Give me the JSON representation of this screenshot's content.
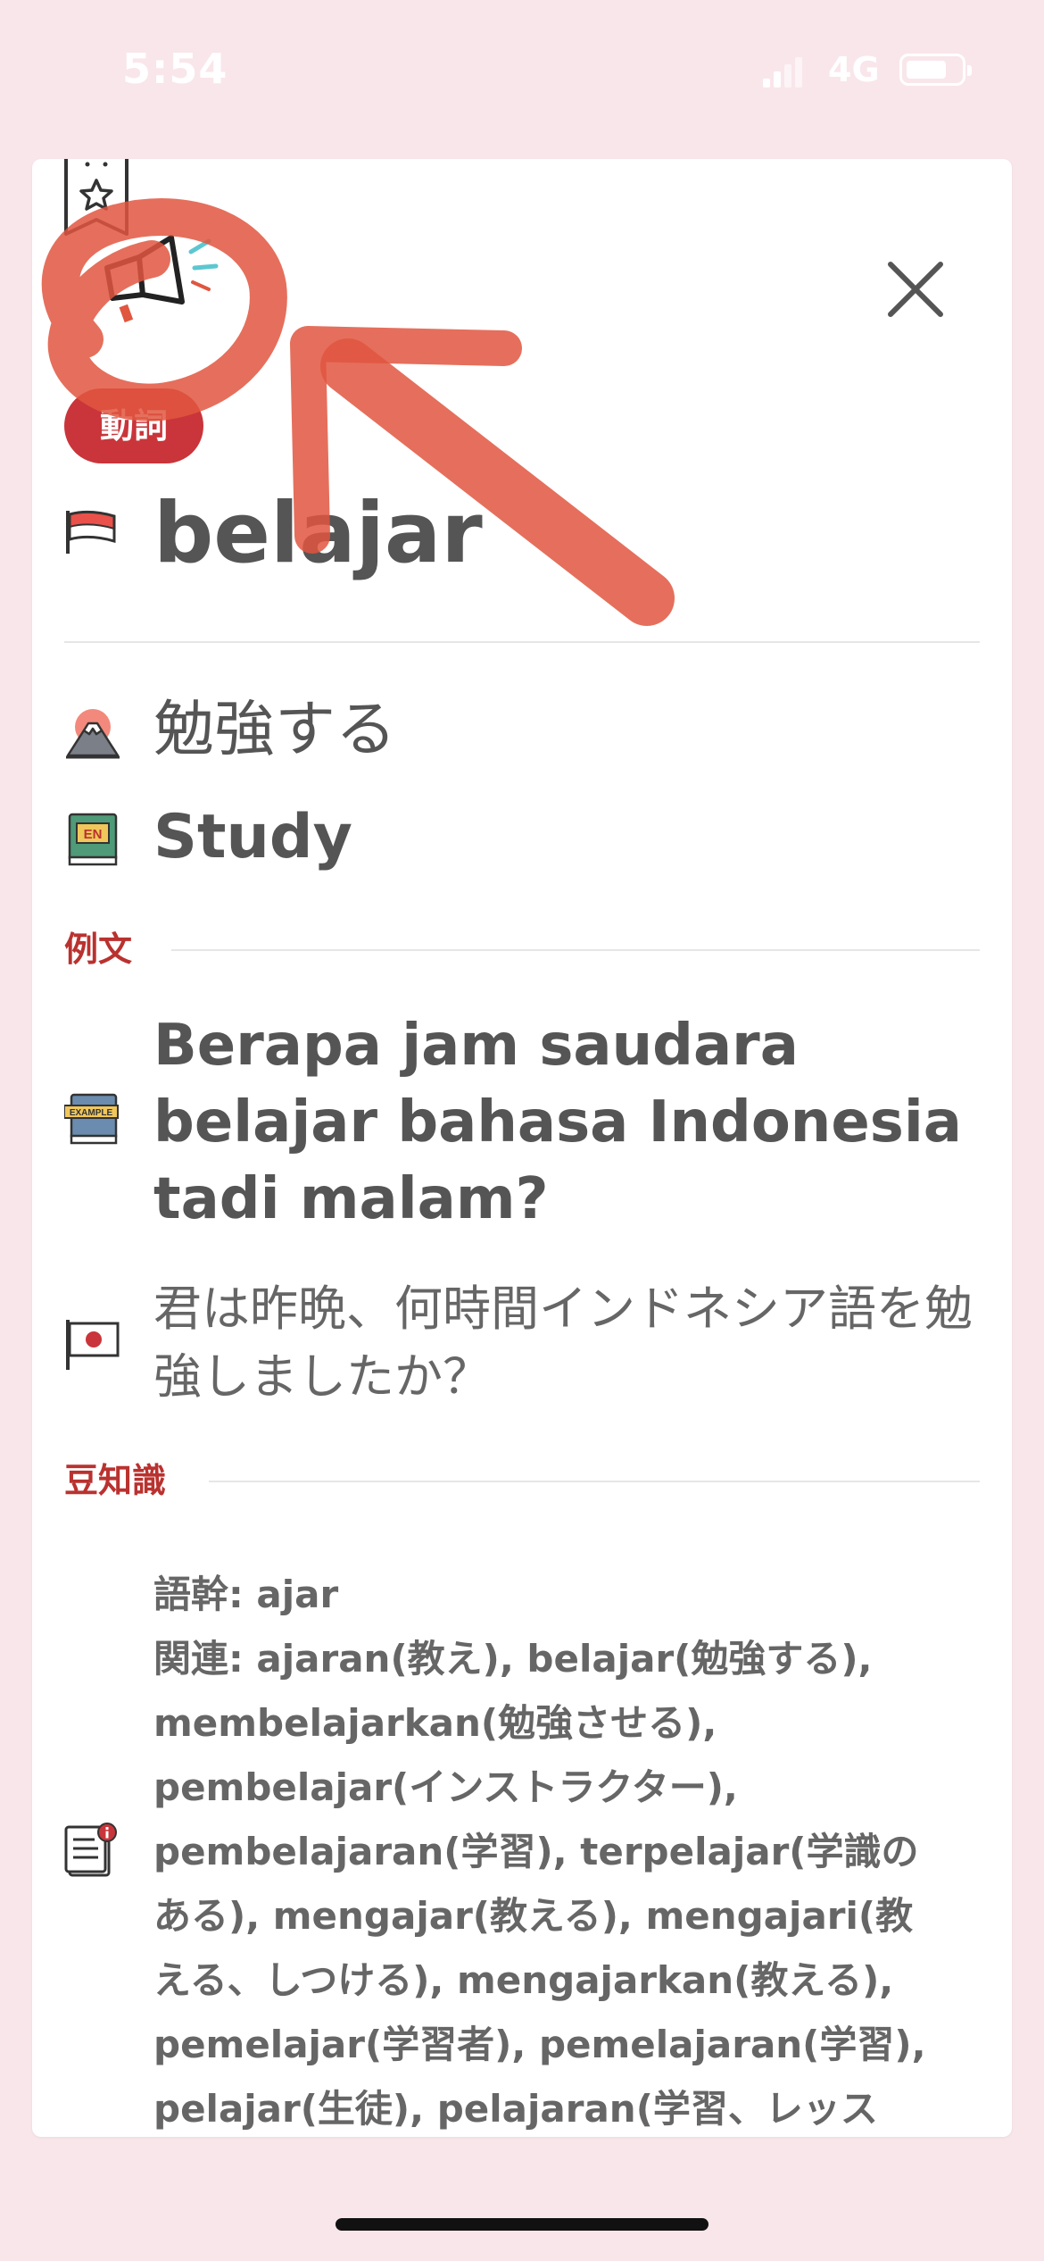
{
  "status_bar": {
    "time": "5:54",
    "network": "4G"
  },
  "card": {
    "part_of_speech": "動詞",
    "headword": "belajar",
    "translation_ja": "勉強する",
    "translation_en": "Study",
    "examples_section": {
      "label": "例文",
      "sentence_id": "Berapa jam saudara belajar bahasa Indonesia tadi malam?",
      "sentence_ja": "君は昨晩、何時間インドネシア語を勉強しましたか？"
    },
    "trivia_section": {
      "label": "豆知識",
      "lines": [
        "語幹: ajar",
        "関連: ajaran(教え), belajar(勉強する),",
        "membelajarkan(勉強させる),",
        "pembelajar(インストラクター),",
        "pembelajaran(学習), terpelajar(学識の",
        "ある), mengajar(教える), mengajari(教",
        "える、しつける), mengajarkan(教える),",
        "pemelajar(学習者), pemelajaran(学習),",
        "pelajar(生徒), pelajaran(学習、レッス"
      ]
    },
    "icons": {
      "bookmark": "bookmark-star-icon",
      "speaker": "megaphone-icon",
      "close": "close-icon",
      "headword_flag": "indonesia-flag-icon",
      "ja_translation": "mount-fuji-icon",
      "en_translation": "en-book-icon",
      "example_sentence": "example-book-icon",
      "example_translation": "japan-flag-icon",
      "trivia": "info-document-icon"
    }
  },
  "colors": {
    "background": "#f9e6ea",
    "accent": "#c9353a",
    "section_label": "#b9322f",
    "annotation": "#e0563f"
  }
}
